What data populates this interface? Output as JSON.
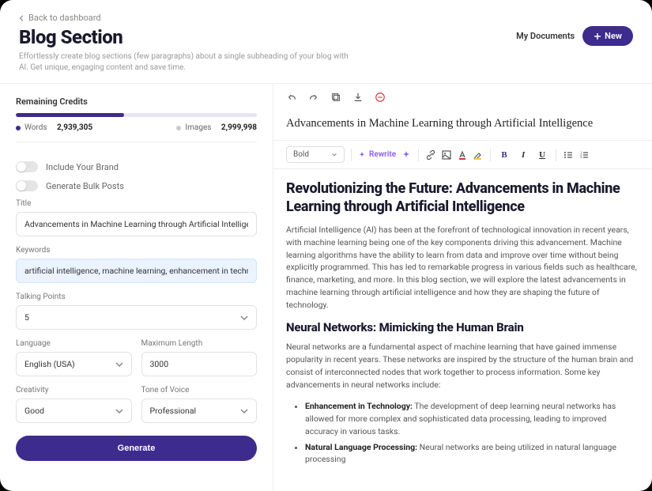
{
  "header": {
    "back": "Back to dashboard",
    "title": "Blog Section",
    "subtitle": "Effortlessly create blog sections (few paragraphs) about a single subheading of your blog with AI. Get unique, engaging content and save time.",
    "my_documents": "My Documents",
    "new": "New"
  },
  "credits": {
    "label": "Remaining Credits",
    "words_label": "Words",
    "words_value": "2,939,305",
    "images_label": "Images",
    "images_value": "2,999,998"
  },
  "toggles": {
    "brand": "Include Your Brand",
    "bulk": "Generate Bulk Posts"
  },
  "form": {
    "title_label": "Title",
    "title_value": "Advancements in Machine Learning through Artificial Intelligence",
    "keywords_label": "Keywords",
    "keywords_value": "artificial intelligence, machine learning, enhancement in technology, ne",
    "talking_label": "Talking Points",
    "talking_value": "5",
    "language_label": "Language",
    "language_value": "English (USA)",
    "maxlen_label": "Maximum Length",
    "maxlen_value": "3000",
    "creativity_label": "Creativity",
    "creativity_value": "Good",
    "tone_label": "Tone of Voice",
    "tone_value": "Professional",
    "generate": "Generate"
  },
  "editor": {
    "doc_title": "Advancements in Machine Learning through Artificial Intelligence",
    "style_select": "Bold",
    "rewrite": "Rewrite",
    "h2": "Revolutionizing the Future: Advancements in Machine Learning through Artificial Intelligence",
    "p1": "Artificial Intelligence (AI) has been at the forefront of technological innovation in recent years, with machine learning being one of the key components driving this advancement. Machine learning algorithms have the ability to learn from data and improve over time without being explicitly programmed. This has led to remarkable progress in various fields such as healthcare, finance, marketing, and more. In this blog section, we will explore the latest advancements in machine learning through artificial intelligence and how they are shaping the future of technology.",
    "h3": "Neural Networks: Mimicking the Human Brain",
    "p2": "Neural networks are a fundamental aspect of machine learning that have gained immense popularity in recent years. These networks are inspired by the structure of the human brain and consist of interconnected nodes that work together to process information. Some key advancements in neural networks include:",
    "li1_strong": "Enhancement in Technology:",
    "li1_text": " The development of deep learning neural networks has allowed for more complex and sophisticated data processing, leading to improved accuracy in various tasks.",
    "li2_strong": "Natural Language Processing:",
    "li2_text": " Neural networks are being utilized in natural language processing"
  }
}
